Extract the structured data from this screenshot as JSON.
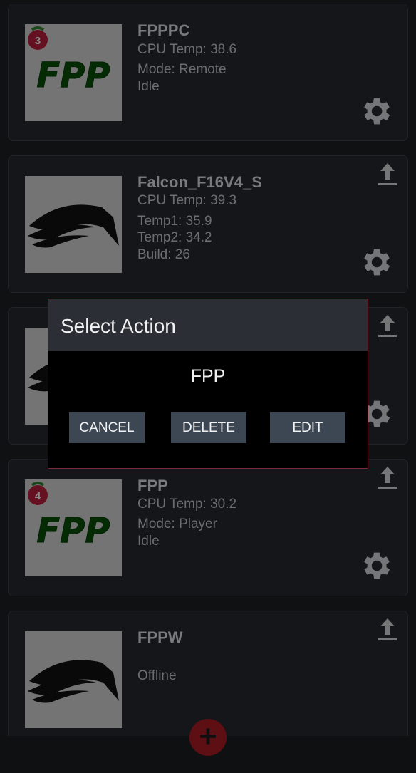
{
  "devices": [
    {
      "name": "FPPPC",
      "lines": [
        "CPU Temp: 38.6",
        "Mode: Remote",
        "Idle"
      ],
      "thumb": "fpp-logo",
      "badge": "3"
    },
    {
      "name": "Falcon_F16V4_S",
      "lines": [
        "CPU Temp: 39.3",
        "Temp1: 35.9",
        "Temp2: 34.2",
        "Build: 26"
      ],
      "thumb": "falcon-logo"
    },
    {
      "name": "",
      "lines": [],
      "thumb": "falcon-logo"
    },
    {
      "name": "FPP",
      "lines": [
        "CPU Temp: 30.2",
        "Mode: Player",
        "Idle"
      ],
      "thumb": "fpp-logo",
      "badge": "4"
    },
    {
      "name": "FPPW",
      "lines": [
        "Offline"
      ],
      "thumb": "falcon-logo"
    }
  ],
  "dialog": {
    "title": "Select Action",
    "message": "FPP",
    "cancel_label": "CANCEL",
    "delete_label": "DELETE",
    "edit_label": "EDIT"
  },
  "fab": {
    "label": "+"
  },
  "colors": {
    "accent": "#a31b22",
    "dialog_border": "#7a2a34",
    "button": "#3d4753",
    "fpp_green": "#0a4a0a"
  }
}
